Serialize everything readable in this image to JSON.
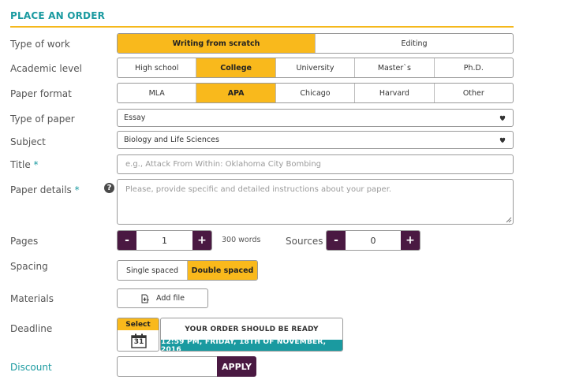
{
  "header": {
    "title": "PLACE AN ORDER"
  },
  "labels": {
    "type_of_work": "Type of work",
    "academic_level": "Academic level",
    "paper_format": "Paper format",
    "type_of_paper": "Type of paper",
    "subject": "Subject",
    "title": "Title",
    "paper_details": "Paper details",
    "pages": "Pages",
    "sources": "Sources",
    "spacing": "Spacing",
    "materials": "Materials",
    "deadline": "Deadline",
    "discount": "Discount",
    "required_mark": "*"
  },
  "type_of_work": {
    "options": [
      "Writing from scratch",
      "Editing"
    ],
    "selected": "Writing from scratch"
  },
  "academic_level": {
    "options": [
      "High school",
      "College",
      "University",
      "Master`s",
      "Ph.D."
    ],
    "selected": "College"
  },
  "paper_format": {
    "options": [
      "MLA",
      "APA",
      "Chicago",
      "Harvard",
      "Other"
    ],
    "selected": "APA"
  },
  "type_of_paper": {
    "value": "Essay"
  },
  "subject": {
    "value": "Biology and Life Sciences"
  },
  "title_field": {
    "value": "",
    "placeholder": "e.g., Attack From Within: Oklahoma City Bombing"
  },
  "details_field": {
    "value": "",
    "placeholder": "Please, provide specific and detailed instructions about your paper."
  },
  "help_icon": "?",
  "pages": {
    "value": "1",
    "minus": "-",
    "plus": "+",
    "words": "300 words"
  },
  "sources": {
    "value": "0",
    "minus": "-",
    "plus": "+"
  },
  "spacing": {
    "options": [
      "Single spaced",
      "Double spaced"
    ],
    "selected": "Double spaced"
  },
  "materials": {
    "button_label": "Add file"
  },
  "deadline": {
    "select_label": "Select",
    "calendar_day": "31",
    "ready_text": "YOUR ORDER SHOULD BE READY",
    "ready_date": "12:59 PM, FRIDAY, 18TH OF NOVEMBER, 2016"
  },
  "discount": {
    "value": "",
    "apply_label": "APPLY"
  },
  "colors": {
    "accent": "#f9b91c",
    "teal": "#1a9aa0",
    "purple": "#4a1942"
  },
  "icons": {
    "dropdown": "chevron-down-icon",
    "file": "file-add-icon",
    "calendar": "calendar-icon",
    "help": "help-icon"
  }
}
